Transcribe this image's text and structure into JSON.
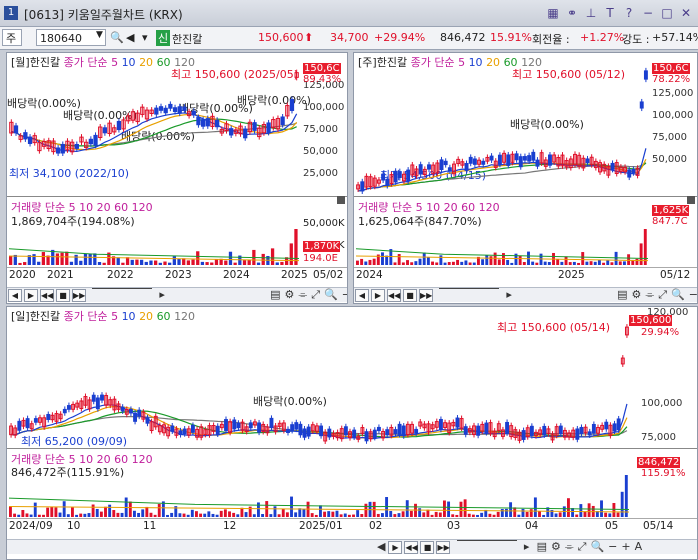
{
  "window": {
    "code": "[0613]",
    "title": "키움일주월차트 (KRX)",
    "num": "1"
  },
  "toolbar": {
    "market": "주",
    "stock_code": "180640",
    "badge": "신",
    "stock_name": "한진칼",
    "price": "150,600",
    "change": "34,700",
    "change_pct": "+29.94%",
    "volume": "846,472",
    "volume_pct": "15.91%",
    "turnover_label": "회전율 :",
    "turnover": "+1.27%",
    "strength_label": "강도 :",
    "strength": "+57.14%"
  },
  "monthly": {
    "header": "[월]한진칼",
    "ma_label": "종가 단순",
    "ma": [
      "5",
      "10",
      "20",
      "60",
      "120"
    ],
    "high_label": "최고 150,600 (2025/05)",
    "low_label": "최저 34,100 (2022/10)",
    "dividends": [
      "배당락(0.00%)",
      "배당락(0.00%)",
      "배당락(0.00%)",
      "배당락(0.00%)",
      "배당락(0.00%)"
    ],
    "price_box": "150,6C",
    "pct_box": "89.43%",
    "y_ticks": [
      "125,000",
      "100,000",
      "75,000",
      "50,000",
      "25,000"
    ],
    "vol_header": "거래량 단순 5 10 20 60 120",
    "vol_value": "1,869,704주(194.08%)",
    "vol_ticks": [
      "50,000K",
      "10,000K"
    ],
    "vol_box": "1,870K",
    "vol_box2": "194.0E",
    "x_labels": [
      "2020",
      "2021",
      "2022",
      "2023",
      "2024",
      "2025",
      "05/02"
    ]
  },
  "weekly": {
    "header": "[주]한진칼",
    "ma_label": "종가 단순",
    "ma": [
      "5",
      "10",
      "20",
      "60",
      "120"
    ],
    "high_label": "최고 150,600 (05/12)",
    "low_label": "최저 54,500 (04/15)",
    "dividends": [
      "배당락(0.00%)"
    ],
    "price_box": "150,6C",
    "pct_box": "78.22%",
    "y_ticks": [
      "125,000",
      "100,000",
      "75,000",
      "50,000"
    ],
    "vol_header": "거래량 단순 5 10 20 60 120",
    "vol_value": "1,625,064주(847.70%)",
    "vol_box": "1,625K",
    "vol_box2": "847.7C",
    "x_labels": [
      "2024",
      "2025",
      "05/12"
    ]
  },
  "daily": {
    "header": "[일]한진칼",
    "ma_label": "종가 단순",
    "ma": [
      "5",
      "10",
      "20",
      "60",
      "120"
    ],
    "high_label": "최고 150,600 (05/14)",
    "low_label": "최저 65,200 (09/09)",
    "dividends": [
      "배당락(0.00%)"
    ],
    "price_box": "150,600",
    "pct_box": "29.94%",
    "top_tick": "120,000",
    "y_ticks": [
      "100,000",
      "75,000"
    ],
    "vol_header": "거래량 단순 5 10 20 60 120",
    "vol_value": "846,472주(115.91%)",
    "vol_box": "846,472",
    "vol_box2": "115.91%",
    "x_labels": [
      "2024/09",
      "10",
      "11",
      "12",
      "2025/01",
      "02",
      "03",
      "04",
      "05",
      "05/14"
    ]
  },
  "colors": {
    "up": "#e0102a",
    "down": "#1a3fd0",
    "ma5": "#c0209c",
    "ma10": "#1a3fd0",
    "ma20": "#e8a000",
    "ma60": "#1a9a2a",
    "ma120": "#777777"
  }
}
